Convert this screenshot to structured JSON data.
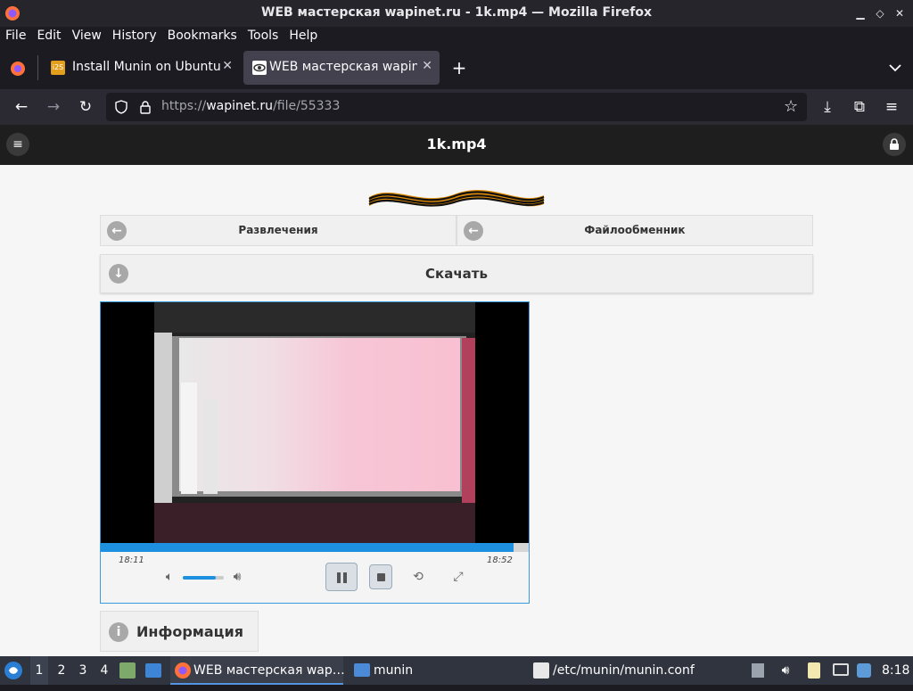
{
  "window": {
    "title": "WEB мастерская wapinet.ru - 1k.mp4 — Mozilla Firefox"
  },
  "menu": [
    "File",
    "Edit",
    "View",
    "History",
    "Bookmarks",
    "Tools",
    "Help"
  ],
  "tabs": [
    {
      "label": "Install Munin on Ubuntu",
      "favicon": "page-icon",
      "active": false
    },
    {
      "label": "WEB мастерская wapinet.ru",
      "favicon": "wapinet-eye-icon",
      "active": true
    }
  ],
  "nav": {
    "url_host_prefix": "https://",
    "url_host": "wapinet.ru",
    "url_path": "/file/55333"
  },
  "site": {
    "title": "1k.mp4",
    "breadcrumbs": [
      {
        "label": "Развлечения"
      },
      {
        "label": "Файлообменник"
      }
    ],
    "download_label": "Скачать",
    "info_label": "Информация"
  },
  "player": {
    "time_current": "18:11",
    "time_total": "18:52",
    "progress_fraction": 0.964,
    "volume_fraction": 0.8
  },
  "taskbar": {
    "workspaces": [
      "1",
      "2",
      "3",
      "4"
    ],
    "active_workspace": "1",
    "windows": [
      {
        "label": "WEB мастерская wap…",
        "icon": "firefox-icon"
      },
      {
        "label": "munin",
        "icon": "folder-icon"
      },
      {
        "label": "/etc/munin/munin.conf",
        "icon": "text-editor-icon"
      }
    ],
    "clock": "8:18"
  },
  "colors": {
    "accent_blue": "#1e90e0",
    "page_bg": "#f6f6f6",
    "site_header": "#1e1e1e"
  }
}
